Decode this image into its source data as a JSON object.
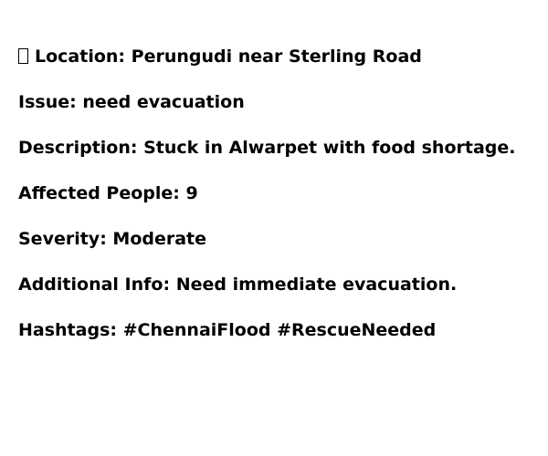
{
  "report": {
    "location": {
      "icon": "pin-icon",
      "label": "Location:",
      "value": "Perungudi near Sterling Road"
    },
    "issue": {
      "label": "Issue:",
      "value": "need evacuation"
    },
    "description": {
      "label": "Description:",
      "value": "Stuck in Alwarpet with food shortage."
    },
    "affected_people": {
      "label": "Affected People:",
      "value": "9"
    },
    "severity": {
      "label": "Severity:",
      "value": "Moderate"
    },
    "additional_info": {
      "label": "Additional Info:",
      "value": "Need immediate evacuation."
    },
    "hashtags": {
      "label": "Hashtags:",
      "value": "#ChennaiFlood #RescueNeeded"
    }
  }
}
